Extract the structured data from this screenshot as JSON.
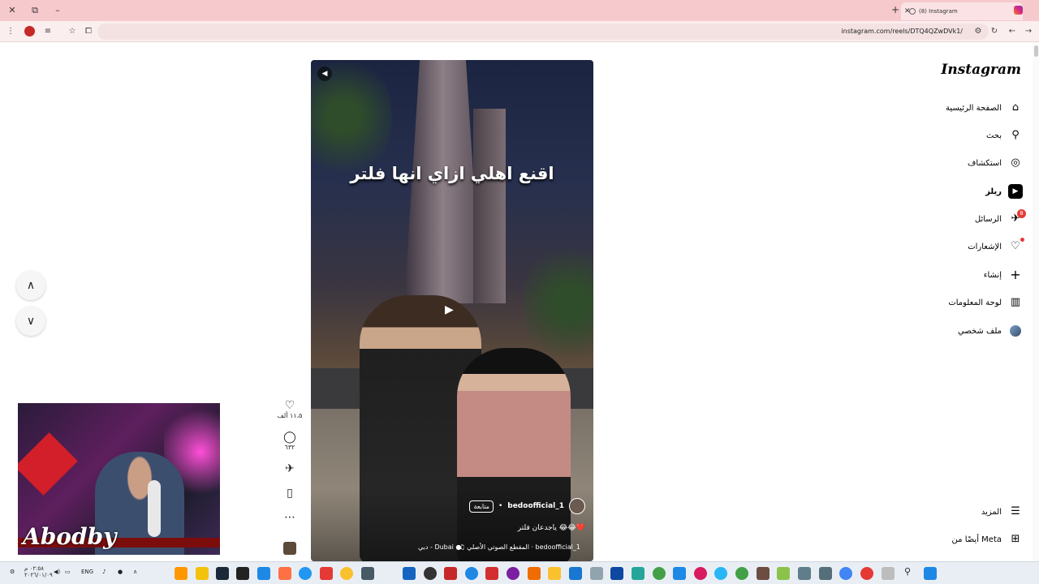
{
  "browser": {
    "tab_title": "(8) Instagram",
    "url": "instagram.com/reels/DTQ4QZwDVk1/",
    "window_controls": [
      "close-icon",
      "restore-icon",
      "minimize-icon"
    ],
    "new_tab": "+"
  },
  "instagram": {
    "logo": "Instagram",
    "nav": [
      {
        "label": "الصفحة الرئيسية",
        "icon": "home-icon",
        "glyph": "⌂"
      },
      {
        "label": "بحث",
        "icon": "search-icon",
        "glyph": "⚲"
      },
      {
        "label": "استكشاف",
        "icon": "compass-icon",
        "glyph": "◎"
      },
      {
        "label": "ريلز",
        "icon": "reels-icon",
        "glyph": "▶"
      },
      {
        "label": "الرسائل",
        "icon": "messages-icon",
        "glyph": "✈",
        "badge": "8"
      },
      {
        "label": "الإشعارات",
        "icon": "heart-icon",
        "glyph": "♡"
      },
      {
        "label": "إنشاء",
        "icon": "plus-icon",
        "glyph": "+"
      },
      {
        "label": "لوحة المعلومات",
        "icon": "dashboard-icon",
        "glyph": "▥"
      },
      {
        "label": "ملف شخصي",
        "icon": "profile-avatar"
      }
    ],
    "more": {
      "label": "المزيد",
      "glyph": "☰"
    },
    "meta": {
      "label": "أيضًا من Meta",
      "glyph": "⊞"
    }
  },
  "reel": {
    "caption_overlay": "اقنع اهلي ازاي انها فلتر",
    "username": "bedoofficial_1",
    "follow": "متابعة",
    "description": "ياجدعان فلتر 😂😂❤️",
    "audio": "المقطع الصوتي الأصلي · bedoofficial_1",
    "location": "دبي - Dubai",
    "likes": "١١،٥ ألف",
    "comments": "٦٣٢"
  },
  "streamer": {
    "brand": "Abodby"
  },
  "taskbar": {
    "lang": "ENG",
    "time": "٠٢:٥٨ م",
    "date": "٢٠٢٦/٠١/٠٩"
  },
  "colors": {
    "titlebar": "#f6c9cd",
    "badge": "#e53935",
    "ig_accent": "#dd2a7b"
  }
}
